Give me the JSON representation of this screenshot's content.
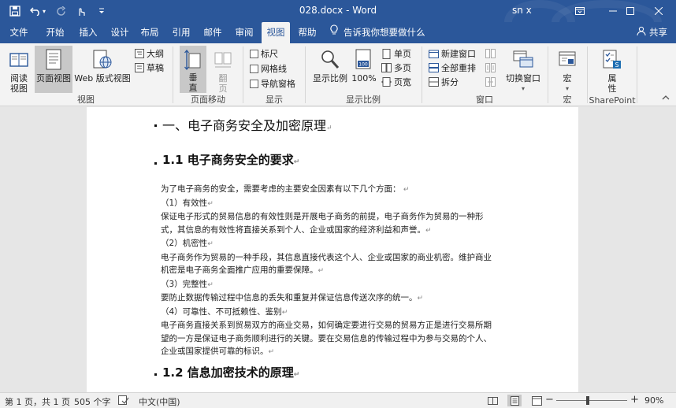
{
  "window": {
    "title": "028.docx  -  Word",
    "user": "sn x"
  },
  "tabs": [
    "文件",
    "开始",
    "插入",
    "设计",
    "布局",
    "引用",
    "邮件",
    "审阅",
    "视图",
    "帮助"
  ],
  "active_tab": "视图",
  "tell_me": "告诉我你想要做什么",
  "share": "共享",
  "ribbon": {
    "views": {
      "label": "视图",
      "read_mode": [
        "阅读",
        "视图"
      ],
      "print_layout": "页面视图",
      "web_layout": "Web 版式视图",
      "outline": "大纲",
      "draft": "草稿"
    },
    "page_movement": {
      "label": "页面移动",
      "vertical": [
        "垂",
        "直"
      ],
      "side_to_side": [
        "翻",
        "页"
      ]
    },
    "show": {
      "label": "显示",
      "ruler": "标尺",
      "gridlines": "网格线",
      "nav_pane": "导航窗格"
    },
    "zoom": {
      "label": "显示比例",
      "zoom": "显示比例",
      "hundred": "100%",
      "one_page": "单页",
      "multi_page": "多页",
      "page_width": "页宽"
    },
    "window_group": {
      "label": "窗口",
      "new_window": "新建窗口",
      "arrange_all": "全部重排",
      "split": "拆分",
      "switch_windows": "切换窗口"
    },
    "macros": {
      "label": "宏",
      "macros": "宏"
    },
    "sharepoint": {
      "label": "SharePoint",
      "properties": [
        "属",
        "性"
      ]
    }
  },
  "document": {
    "heading1": "一、电子商务安全及加密原理",
    "heading2a": "1.1 电子商务安全的要求",
    "lines": [
      "为了电子商务的安全，需要考虑的主要安全因素有以下几个方面：",
      "（1）有效性",
      "保证电子形式的贸易信息的有效性则是开展电子商务的前提，电子商务作为贸易的一种形",
      "式，其信息的有效性将直接关系到个人、企业或国家的经济利益和声誉。",
      "（2）机密性",
      "电子商务作为贸易的一种手段，其信息直接代表这个人、企业或国家的商业机密。维护商业",
      "机密是电子商务全面推广应用的重要保障。",
      "（3）完整性",
      "要防止数据传输过程中信息的丢失和重复并保证信息传送次序的统一。",
      "（4）可靠性、不可抵赖性、鉴别",
      "电子商务直接关系到贸易双方的商业交易，如何确定要进行交易的贸易方正是进行交易所期",
      "望的一方是保证电子商务顺利进行的关键。要在交易信息的传输过程中为参与交易的个人、",
      "企业或国家提供可靠的标识。"
    ],
    "heading2b": "1.2 信息加密技术的原理",
    "para_mark": "↵"
  },
  "status": {
    "page": "第 1 页，共 1 页",
    "words": "505 个字",
    "language": "中文(中国)",
    "zoom_minus": "−",
    "zoom_plus": "+",
    "zoom": "90%",
    "zoom_level_percent": 90
  },
  "colors": {
    "accent": "#2b579a"
  }
}
